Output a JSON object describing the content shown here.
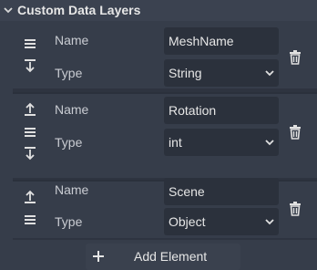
{
  "section": {
    "title": "Custom Data Layers"
  },
  "layers": [
    {
      "name_label": "Name",
      "name_value": "MeshName",
      "type_label": "Type",
      "type_value": "String"
    },
    {
      "name_label": "Name",
      "name_value": "Rotation",
      "type_label": "Type",
      "type_value": "int"
    },
    {
      "name_label": "Name",
      "name_value": "Scene",
      "type_label": "Type",
      "type_value": "Object"
    }
  ],
  "add_button": {
    "label": "Add Element"
  },
  "colors": {
    "panel_bg": "#363d4a",
    "field_bg": "#2b313c",
    "text": "#e6e6e6"
  },
  "icons": [
    "chevron-down-icon",
    "drag-handle-icon",
    "move-down-icon",
    "move-up-icon",
    "trash-icon",
    "dropdown-arrow-icon",
    "plus-icon"
  ]
}
